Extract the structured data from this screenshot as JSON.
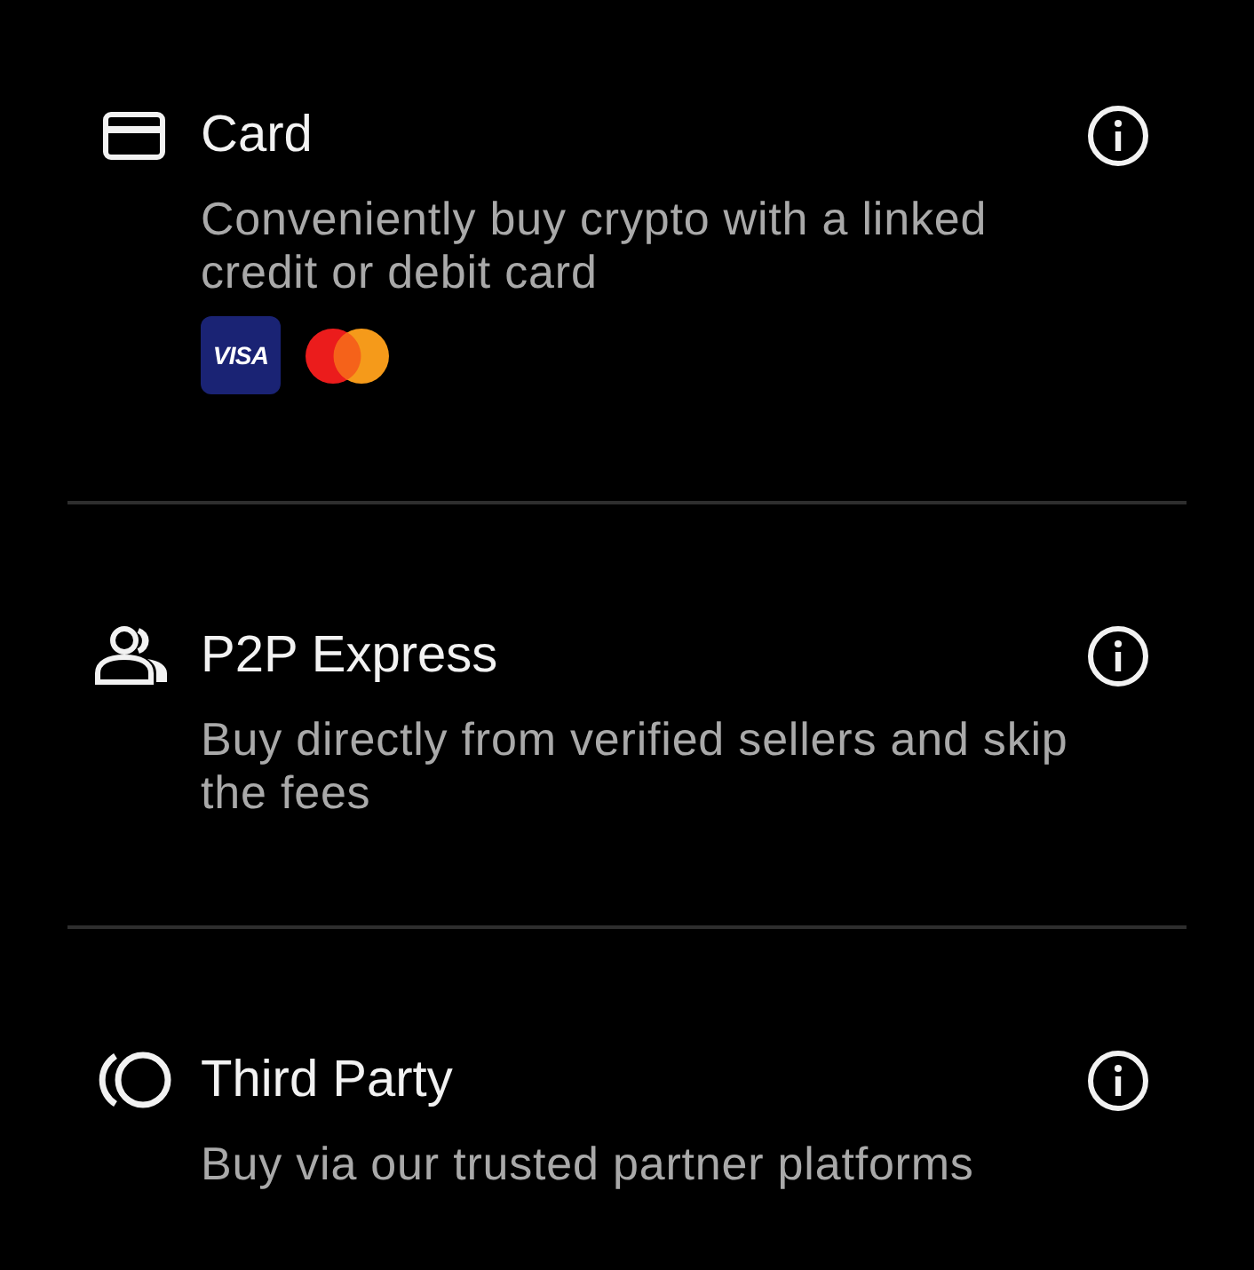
{
  "options": [
    {
      "kind": "card",
      "title": "Card",
      "description": "Conveniently buy crypto with a linked credit or debit card",
      "payment_logos": [
        {
          "kind": "visa",
          "label": "VISA"
        },
        {
          "kind": "mastercard"
        }
      ]
    },
    {
      "kind": "p2p",
      "title": "P2P Express",
      "description": "Buy directly from verified sellers and skip the fees"
    },
    {
      "kind": "third_party",
      "title": "Third Party",
      "description": "Buy via our trusted partner platforms"
    }
  ]
}
